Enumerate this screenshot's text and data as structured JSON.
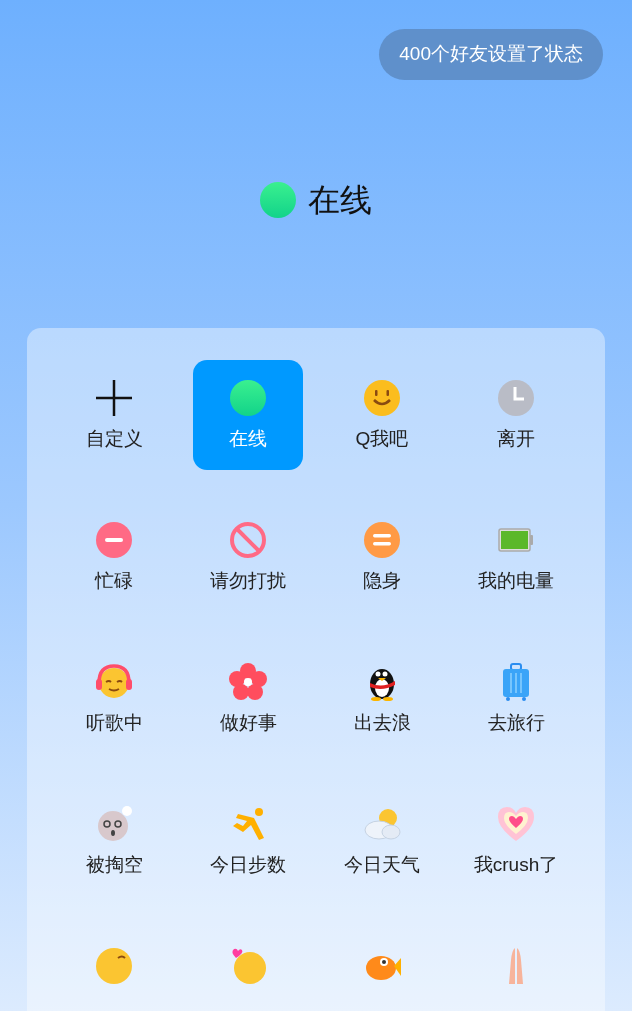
{
  "friends_badge": "400个好友设置了状态",
  "current_status": {
    "label": "在线"
  },
  "statuses": [
    {
      "label": "自定义",
      "selected": false
    },
    {
      "label": "在线",
      "selected": true
    },
    {
      "label": "Q我吧",
      "selected": false
    },
    {
      "label": "离开",
      "selected": false
    },
    {
      "label": "忙碌",
      "selected": false
    },
    {
      "label": "请勿打扰",
      "selected": false
    },
    {
      "label": "隐身",
      "selected": false
    },
    {
      "label": "我的电量",
      "selected": false
    },
    {
      "label": "听歌中",
      "selected": false
    },
    {
      "label": "做好事",
      "selected": false
    },
    {
      "label": "出去浪",
      "selected": false
    },
    {
      "label": "去旅行",
      "selected": false
    },
    {
      "label": "被掏空",
      "selected": false
    },
    {
      "label": "今日步数",
      "selected": false
    },
    {
      "label": "今日天气",
      "selected": false
    },
    {
      "label": "我crush了",
      "selected": false
    },
    {
      "selected": false
    },
    {
      "selected": false
    },
    {
      "selected": false
    },
    {
      "selected": false
    }
  ]
}
